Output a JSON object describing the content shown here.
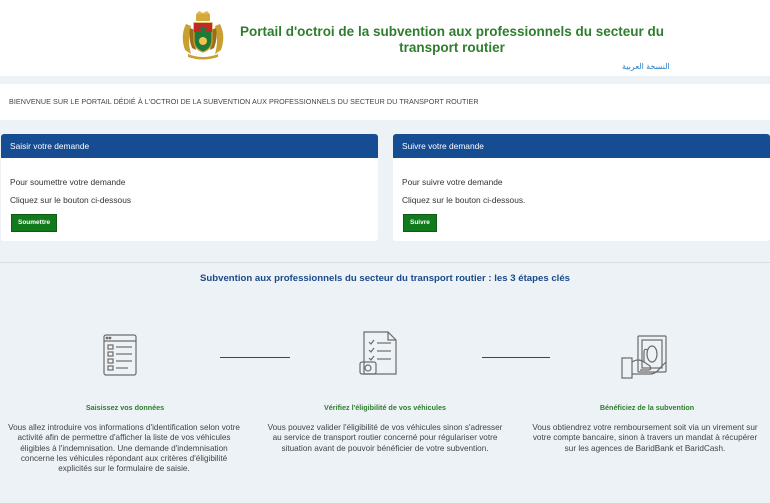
{
  "header": {
    "title": "Portail d'octroi de la subvention aux professionnels du secteur du transport routier",
    "arabic_link": "النسخة العربية",
    "emblem_icon": "morocco-coat-of-arms-icon"
  },
  "welcome": {
    "text": "BIENVENUE SUR LE PORTAIL DÉDIÉ À L'OCTROI DE LA SUBVENTION AUX PROFESSIONNELS DU SECTEUR DU TRANSPORT ROUTIER"
  },
  "cards": [
    {
      "header": "Saisir votre demande",
      "line1": "Pour soumettre votre demande",
      "line2": "Cliquez sur le bouton ci-dessous",
      "button": "Soumettre"
    },
    {
      "header": "Suivre votre demande",
      "line1": "Pour suivre votre demande",
      "line2": "Cliquez sur le bouton ci-dessous.",
      "button": "Suivre"
    }
  ],
  "steps_title": "Subvention aux professionnels du secteur du transport routier : les 3 étapes clés",
  "steps": [
    {
      "icon": "form-entry-icon",
      "label": "Saisissez vos données",
      "description": "Vous allez introduire vos informations d'identification selon votre activité afin de permettre d'afficher la liste de vos véhicules éligibles à l'indemnisation. Une demande d'indemnisation concerne les véhicules répondant aux critères d'éligibilité explicités sur le formulaire de saisie."
    },
    {
      "icon": "document-checklist-icon",
      "label": "Vérifiez l'éligibilité de vos véhicules",
      "description": "Vous pouvez valider l'éligibilité de vos véhicules sinon s'adresser au service de transport routier concerné pour régulariser votre situation avant de pouvoir bénéficier de votre subvention."
    },
    {
      "icon": "hand-money-icon",
      "label": "Bénéficiez de la subvention",
      "description": "Vous obtiendrez votre remboursement soit via un virement sur votre compte bancaire, sinon à travers un mandat à récupérer sur les agences de BaridBank et BaridCash."
    }
  ],
  "colors": {
    "brand_green": "#2f7d2e",
    "button_green": "#117a1c",
    "header_blue": "#154c92",
    "link_blue": "#2d7ec2",
    "background": "#edf2f6"
  }
}
